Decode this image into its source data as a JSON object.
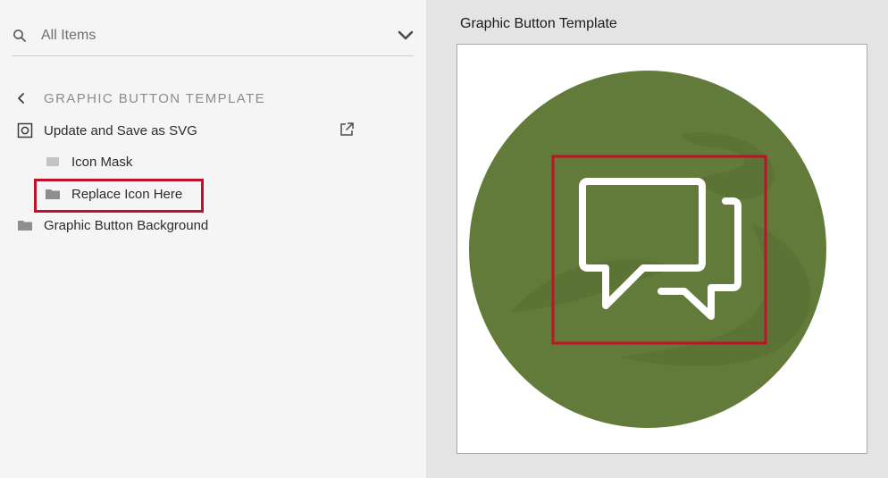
{
  "sidebar": {
    "search": {
      "label": "All Items",
      "icon": "search-icon",
      "dropdown_icon": "chevron-down-icon"
    },
    "breadcrumb": {
      "title": "GRAPHIC BUTTON TEMPLATE",
      "back_icon": "chevron-left-icon"
    },
    "items": [
      {
        "label": "Update and Save as SVG",
        "icon": "target-square-icon",
        "action_icon": "external-link-icon"
      },
      {
        "label": "Icon Mask",
        "icon": "gray-rect-icon"
      },
      {
        "label": "Replace Icon Here",
        "icon": "folder-icon",
        "highlighted": true
      },
      {
        "label": "Graphic Button Background",
        "icon": "folder-icon"
      }
    ]
  },
  "preview": {
    "title": "Graphic Button Template",
    "circle_color": "#627b3a",
    "highlight_color": "#c0112b",
    "icon": "chat-bubbles-icon"
  }
}
